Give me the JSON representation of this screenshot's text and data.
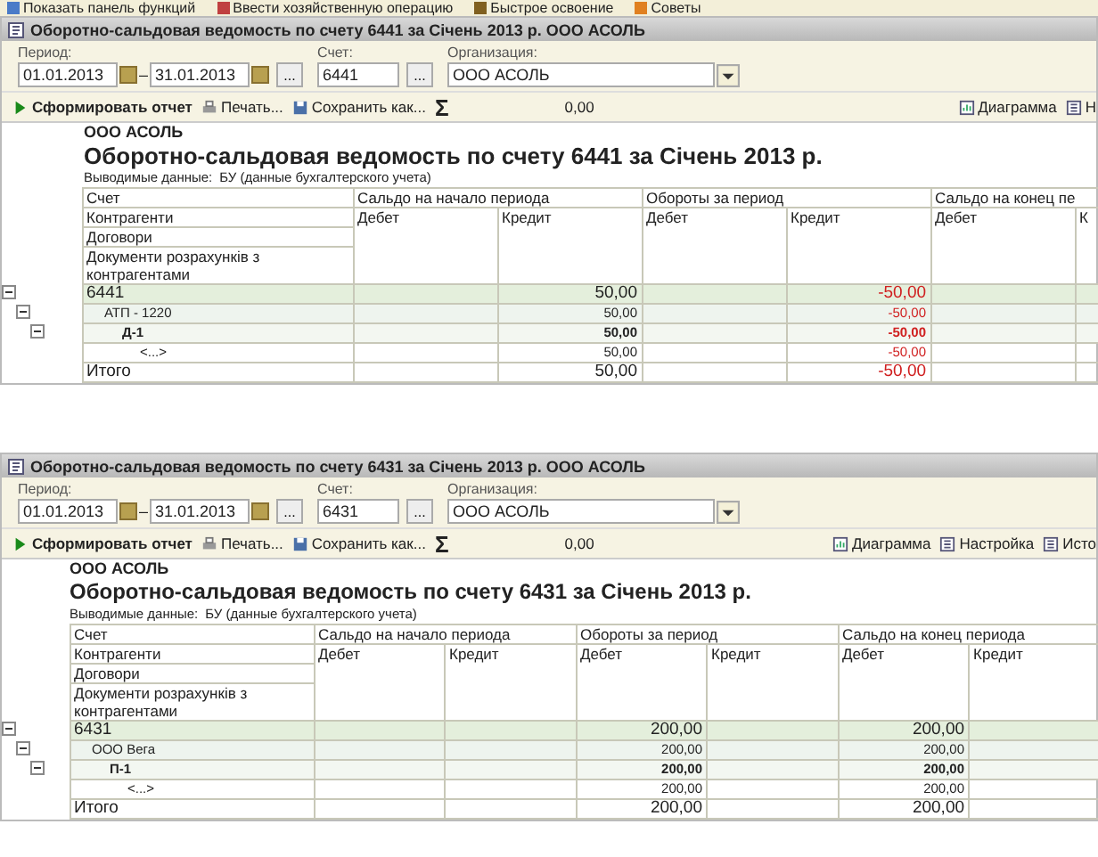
{
  "top_commands": [
    {
      "kind": "panel",
      "label": "Показать панель функций"
    },
    {
      "kind": "operation",
      "label": "Ввести хозяйственную операцию"
    },
    {
      "kind": "learn",
      "label": "Быстрое освоение"
    },
    {
      "kind": "tips",
      "label": "Советы"
    }
  ],
  "reports": [
    {
      "title": "Оборотно-сальдовая ведомость по счету 6441 за Січень 2013 р. ООО АСОЛЬ",
      "form": {
        "period_label": "Период:",
        "date_from": "01.01.2013",
        "dash": "–",
        "date_to": "31.01.2013",
        "period_button": "...",
        "account_label": "Счет:",
        "account": "6441",
        "account_button": "...",
        "org_label": "Организация:",
        "org": "ООО АСОЛЬ"
      },
      "toolbar": {
        "left": [
          {
            "kind": "run",
            "label": "Сформировать отчет"
          },
          {
            "kind": "print",
            "label": "Печать..."
          },
          {
            "kind": "save",
            "label": "Сохранить как..."
          },
          {
            "kind": "sum",
            "label": "Σ"
          }
        ],
        "sum_value": "0,00",
        "right": [
          {
            "kind": "chart",
            "label": "Диаграмма"
          },
          {
            "kind": "settings",
            "label": "Н"
          }
        ]
      },
      "org_name": "ООО АСОЛЬ",
      "heading": "Оборотно-сальдовая ведомость по счету 6441 за Січень 2013 р.",
      "output_label": "Выводимые данные:",
      "output_value": "БУ (данные бухгалтерского учета)",
      "columns": {
        "account_levels": [
          "Счет",
          "Контрагенти",
          "Договори",
          "Документи розрахунків з контрагентами"
        ],
        "groups": [
          {
            "label": "Сальдо на начало периода",
            "sub": [
              "Дебет",
              "Кредит"
            ]
          },
          {
            "label": "Обороты за период",
            "sub": [
              "Дебет",
              "Кредит"
            ]
          },
          {
            "label": "Сальдо на конец пе",
            "sub": [
              "Дебет",
              "К"
            ]
          }
        ]
      },
      "rows": [
        {
          "label": "6441",
          "expanded": true,
          "cells": [
            null,
            {
              "text": "50,00",
              "negative": false
            },
            null,
            {
              "text": "-50,00",
              "negative": true
            },
            null,
            null
          ],
          "children": [
            {
              "label": "АТП - 1220",
              "expanded": true,
              "cells": [
                null,
                {
                  "text": "50,00",
                  "negative": false
                },
                null,
                {
                  "text": "-50,00",
                  "negative": true
                },
                null,
                null
              ],
              "children": [
                {
                  "label": "Д-1",
                  "expanded": true,
                  "cells": [
                    null,
                    {
                      "text": "50,00",
                      "negative": false
                    },
                    null,
                    {
                      "text": "-50,00",
                      "negative": true
                    },
                    null,
                    null
                  ],
                  "children": [
                    {
                      "label": "<...>",
                      "cells": [
                        null,
                        {
                          "text": "50,00",
                          "negative": false
                        },
                        null,
                        {
                          "text": "-50,00",
                          "negative": true
                        },
                        null,
                        null
                      ]
                    }
                  ]
                }
              ]
            }
          ]
        }
      ],
      "total": {
        "label": "Итого",
        "cells": [
          null,
          {
            "text": "50,00",
            "negative": false
          },
          null,
          {
            "text": "-50,00",
            "negative": true
          },
          null,
          null
        ]
      }
    },
    {
      "title": "Оборотно-сальдовая ведомость по счету 6431 за Січень 2013 р. ООО АСОЛЬ",
      "form": {
        "period_label": "Период:",
        "date_from": "01.01.2013",
        "dash": "–",
        "date_to": "31.01.2013",
        "period_button": "...",
        "account_label": "Счет:",
        "account": "6431",
        "account_button": "...",
        "org_label": "Организация:",
        "org": "ООО АСОЛЬ"
      },
      "toolbar": {
        "left": [
          {
            "kind": "run",
            "label": "Сформировать отчет"
          },
          {
            "kind": "print",
            "label": "Печать..."
          },
          {
            "kind": "save",
            "label": "Сохранить как..."
          },
          {
            "kind": "sum",
            "label": "Σ"
          }
        ],
        "sum_value": "0,00",
        "right": [
          {
            "kind": "chart",
            "label": "Диаграмма"
          },
          {
            "kind": "settings",
            "label": "Настройка"
          },
          {
            "kind": "history",
            "label": "Исто"
          }
        ]
      },
      "org_name": "ООО АСОЛЬ",
      "heading": "Оборотно-сальдовая ведомость по счету 6431 за Січень 2013 р.",
      "output_label": "Выводимые данные:",
      "output_value": "БУ (данные бухгалтерского учета)",
      "columns": {
        "account_levels": [
          "Счет",
          "Контрагенти",
          "Договори",
          "Документи розрахунків з контрагентами"
        ],
        "groups": [
          {
            "label": "Сальдо на начало периода",
            "sub": [
              "Дебет",
              "Кредит"
            ]
          },
          {
            "label": "Обороты за период",
            "sub": [
              "Дебет",
              "Кредит"
            ]
          },
          {
            "label": "Сальдо на конец периода",
            "sub": [
              "Дебет",
              "Кредит"
            ]
          }
        ]
      },
      "rows": [
        {
          "label": "6431",
          "expanded": true,
          "cells": [
            null,
            null,
            {
              "text": "200,00",
              "negative": false
            },
            null,
            {
              "text": "200,00",
              "negative": false
            },
            null
          ],
          "children": [
            {
              "label": "ООО Вега",
              "expanded": true,
              "cells": [
                null,
                null,
                {
                  "text": "200,00",
                  "negative": false
                },
                null,
                {
                  "text": "200,00",
                  "negative": false
                },
                null
              ],
              "children": [
                {
                  "label": "П-1",
                  "expanded": true,
                  "cells": [
                    null,
                    null,
                    {
                      "text": "200,00",
                      "negative": false
                    },
                    null,
                    {
                      "text": "200,00",
                      "negative": false
                    },
                    null
                  ],
                  "children": [
                    {
                      "label": "<...>",
                      "cells": [
                        null,
                        null,
                        {
                          "text": "200,00",
                          "negative": false
                        },
                        null,
                        {
                          "text": "200,00",
                          "negative": false
                        },
                        null
                      ]
                    }
                  ]
                }
              ]
            }
          ]
        }
      ],
      "total": {
        "label": "Итого",
        "cells": [
          null,
          null,
          {
            "text": "200,00",
            "negative": false
          },
          null,
          {
            "text": "200,00",
            "negative": false
          },
          null
        ]
      }
    }
  ]
}
